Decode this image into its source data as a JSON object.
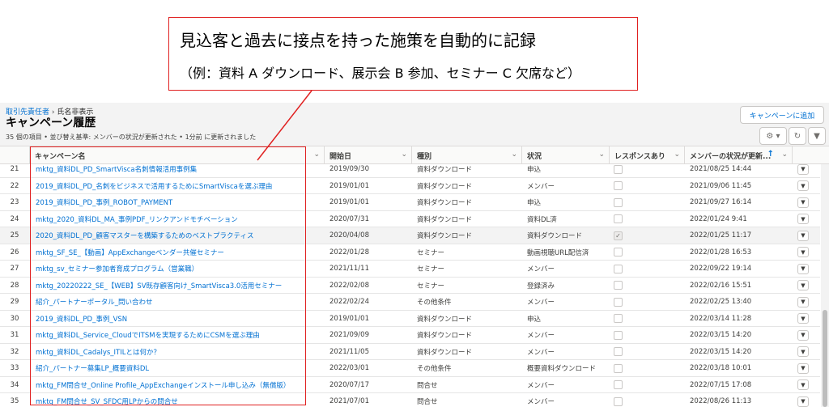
{
  "callout": {
    "line1": "見込客と過去に接点を持った施策を自動的に記録",
    "line2": "（例：資料 A ダウンロード、展示会 B 参加、セミナー C 欠席など）"
  },
  "breadcrumb": {
    "parent": "取引先責任者",
    "separator": "›",
    "record": "氏名非表示"
  },
  "page_title": "キャンペーン履歴",
  "summary": "35 個の項目 • 並び替え基準: メンバーの状況が更新された • 1分前 に更新されました",
  "add_button": "キャンペーンに追加",
  "icons": {
    "settings": "gear-icon",
    "refresh": "refresh-icon",
    "filter": "filter-icon"
  },
  "columns": {
    "name": "キャンペーン名",
    "start": "開始日",
    "type": "種別",
    "status": "状況",
    "responded": "レスポンスあり",
    "updated": "メンバーの状況が更新..."
  },
  "rows": [
    {
      "n": "21",
      "name": "mktg_資料DL_PD_SmartVisca名刺情報活用事例集",
      "date": "2019/09/30",
      "type": "資料ダウンロード",
      "status": "申込",
      "resp": false,
      "upd": "2021/08/25 14:44"
    },
    {
      "n": "22",
      "name": "2019_資料DL_PD_名刺をビジネスで活用するためにSmartViscaを選ぶ理由",
      "date": "2019/01/01",
      "type": "資料ダウンロード",
      "status": "メンバー",
      "resp": false,
      "upd": "2021/09/06 11:45"
    },
    {
      "n": "23",
      "name": "2019_資料DL_PD_事例_ROBOT_PAYMENT",
      "date": "2019/01/01",
      "type": "資料ダウンロード",
      "status": "申込",
      "resp": false,
      "upd": "2021/09/27 16:14"
    },
    {
      "n": "24",
      "name": "mktg_2020_資料DL_MA_事例PDF_リンクアンドモチベーション",
      "date": "2020/07/31",
      "type": "資料ダウンロード",
      "status": "資料DL済",
      "resp": false,
      "upd": "2022/01/24 9:41"
    },
    {
      "n": "25",
      "name": "2020_資料DL_PD_顧客マスターを構築するためのベストプラクティス",
      "date": "2020/04/08",
      "type": "資料ダウンロード",
      "status": "資料ダウンロード",
      "resp": true,
      "upd": "2022/01/25 11:17"
    },
    {
      "n": "26",
      "name": "mktg_SF_SE_【動画】AppExchangeベンダー共催セミナー",
      "date": "2022/01/28",
      "type": "セミナー",
      "status": "動画視聴URL配信済",
      "resp": false,
      "upd": "2022/01/28 16:53"
    },
    {
      "n": "27",
      "name": "mktg_sv_セミナー参加者育成プログラム（営業職）",
      "date": "2021/11/11",
      "type": "セミナー",
      "status": "メンバー",
      "resp": false,
      "upd": "2022/09/22 19:14"
    },
    {
      "n": "28",
      "name": "mktg_20220222_SE_【WEB】SV既存顧客向け_SmartVisca3.0活用セミナー",
      "date": "2022/02/08",
      "type": "セミナー",
      "status": "登録済み",
      "resp": false,
      "upd": "2022/02/16 15:51"
    },
    {
      "n": "29",
      "name": "紹介_パートナーポータル_問い合わせ",
      "date": "2022/02/24",
      "type": "その他条件",
      "status": "メンバー",
      "resp": false,
      "upd": "2022/02/25 13:40"
    },
    {
      "n": "30",
      "name": "2019_資料DL_PD_事例_VSN",
      "date": "2019/01/01",
      "type": "資料ダウンロード",
      "status": "申込",
      "resp": false,
      "upd": "2022/03/14 11:28"
    },
    {
      "n": "31",
      "name": "mktg_資料DL_Service_CloudでITSMを実現するためにCSMを選ぶ理由",
      "date": "2021/09/09",
      "type": "資料ダウンロード",
      "status": "メンバー",
      "resp": false,
      "upd": "2022/03/15 14:20"
    },
    {
      "n": "32",
      "name": "mktg_資料DL_Cadalys_ITILとは何か？",
      "date": "2021/11/05",
      "type": "資料ダウンロード",
      "status": "メンバー",
      "resp": false,
      "upd": "2022/03/15 14:20"
    },
    {
      "n": "33",
      "name": "紹介_パートナー募集LP_概要資料DL",
      "date": "2022/03/01",
      "type": "その他条件",
      "status": "概要資料ダウンロード",
      "resp": false,
      "upd": "2022/03/18 10:01"
    },
    {
      "n": "34",
      "name": "mktg_FM問合せ_Online Profile_AppExchangeインストール申し込み（無償版）",
      "date": "2020/07/17",
      "type": "問合せ",
      "status": "メンバー",
      "resp": false,
      "upd": "2022/07/15 17:08"
    },
    {
      "n": "35",
      "name": "mktg_FM問合せ_SV_SFDC用LPからの問合せ",
      "date": "2021/07/01",
      "type": "問合せ",
      "status": "メンバー",
      "resp": false,
      "upd": "2022/08/26 11:13"
    }
  ]
}
